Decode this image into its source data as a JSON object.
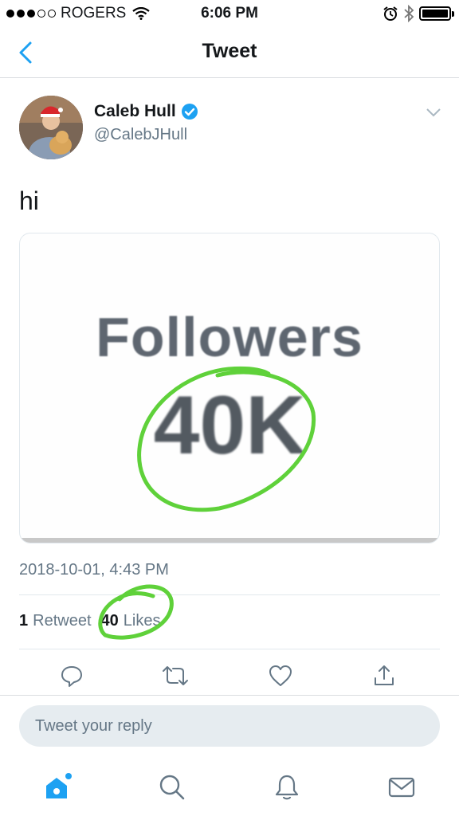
{
  "status_bar": {
    "carrier": "ROGERS",
    "time": "6:06 PM",
    "signal_bars": 3,
    "signal_total": 5,
    "battery_level": 1.0
  },
  "nav": {
    "title": "Tweet",
    "back_icon": "chevron-left-icon"
  },
  "tweet": {
    "author_name": "Caleb Hull",
    "handle": "@CalebJHull",
    "verified": true,
    "text": "hi",
    "timestamp": "2018-10-01, 4:43 PM",
    "media": {
      "label": "Followers",
      "value": "40K",
      "highlight_color": "#5fd13a"
    },
    "stats": {
      "retweets_count": "1",
      "retweets_label": "Retweet",
      "likes_count": "40",
      "likes_label": "Likes"
    },
    "actions": [
      "reply-icon",
      "retweet-icon",
      "like-icon",
      "share-icon"
    ]
  },
  "reply": {
    "placeholder": "Tweet your reply"
  },
  "tab_bar": {
    "tabs": [
      "home-icon",
      "search-icon",
      "notifications-icon",
      "messages-icon"
    ],
    "active": "home-icon"
  },
  "colors": {
    "accent": "#1da1f2",
    "secondary_text": "#657786",
    "highlight": "#5fd13a"
  }
}
